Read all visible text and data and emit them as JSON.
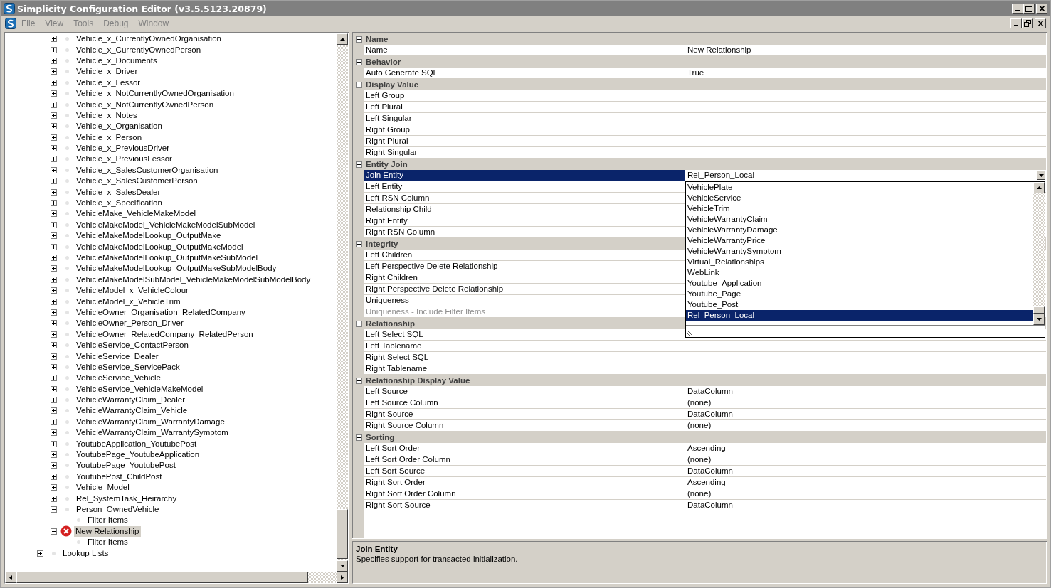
{
  "window": {
    "title": "Simplicity Configuration Editor (v3.5.5123.20879)",
    "active": false
  },
  "menu": [
    {
      "label": "File",
      "disabled": true
    },
    {
      "label": "View",
      "disabled": true
    },
    {
      "label": "Tools",
      "disabled": true
    },
    {
      "label": "Debug",
      "disabled": true
    },
    {
      "label": "Window",
      "disabled": true
    }
  ],
  "tree": {
    "items": [
      {
        "label": "Vehicle_x_CurrentlyOwnedOrganisation",
        "expanded": false,
        "selected": false,
        "error": false
      },
      {
        "label": "Vehicle_x_CurrentlyOwnedPerson",
        "expanded": false,
        "selected": false,
        "error": false
      },
      {
        "label": "Vehicle_x_Documents",
        "expanded": false,
        "selected": false,
        "error": false
      },
      {
        "label": "Vehicle_x_Driver",
        "expanded": false,
        "selected": false,
        "error": false
      },
      {
        "label": "Vehicle_x_Lessor",
        "expanded": false,
        "selected": false,
        "error": false
      },
      {
        "label": "Vehicle_x_NotCurrentlyOwnedOrganisation",
        "expanded": false,
        "selected": false,
        "error": false
      },
      {
        "label": "Vehicle_x_NotCurrentlyOwnedPerson",
        "expanded": false,
        "selected": false,
        "error": false
      },
      {
        "label": "Vehicle_x_Notes",
        "expanded": false,
        "selected": false,
        "error": false
      },
      {
        "label": "Vehicle_x_Organisation",
        "expanded": false,
        "selected": false,
        "error": false
      },
      {
        "label": "Vehicle_x_Person",
        "expanded": false,
        "selected": false,
        "error": false
      },
      {
        "label": "Vehicle_x_PreviousDriver",
        "expanded": false,
        "selected": false,
        "error": false
      },
      {
        "label": "Vehicle_x_PreviousLessor",
        "expanded": false,
        "selected": false,
        "error": false
      },
      {
        "label": "Vehicle_x_SalesCustomerOrganisation",
        "expanded": false,
        "selected": false,
        "error": false
      },
      {
        "label": "Vehicle_x_SalesCustomerPerson",
        "expanded": false,
        "selected": false,
        "error": false
      },
      {
        "label": "Vehicle_x_SalesDealer",
        "expanded": false,
        "selected": false,
        "error": false
      },
      {
        "label": "Vehicle_x_Specification",
        "expanded": false,
        "selected": false,
        "error": false
      },
      {
        "label": "VehicleMake_VehicleMakeModel",
        "expanded": false,
        "selected": false,
        "error": false
      },
      {
        "label": "VehicleMakeModel_VehicleMakeModelSubModel",
        "expanded": false,
        "selected": false,
        "error": false
      },
      {
        "label": "VehicleMakeModelLookup_OutputMake",
        "expanded": false,
        "selected": false,
        "error": false
      },
      {
        "label": "VehicleMakeModelLookup_OutputMakeModel",
        "expanded": false,
        "selected": false,
        "error": false
      },
      {
        "label": "VehicleMakeModelLookup_OutputMakeSubModel",
        "expanded": false,
        "selected": false,
        "error": false
      },
      {
        "label": "VehicleMakeModelLookup_OutputMakeSubModelBody",
        "expanded": false,
        "selected": false,
        "error": false
      },
      {
        "label": "VehicleMakeModelSubModel_VehicleMakeModelSubModelBody",
        "expanded": false,
        "selected": false,
        "error": false
      },
      {
        "label": "VehicleModel_x_VehicleColour",
        "expanded": false,
        "selected": false,
        "error": false
      },
      {
        "label": "VehicleModel_x_VehicleTrim",
        "expanded": false,
        "selected": false,
        "error": false
      },
      {
        "label": "VehicleOwner_Organisation_RelatedCompany",
        "expanded": false,
        "selected": false,
        "error": false
      },
      {
        "label": "VehicleOwner_Person_Driver",
        "expanded": false,
        "selected": false,
        "error": false
      },
      {
        "label": "VehicleOwner_RelatedCompany_RelatedPerson",
        "expanded": false,
        "selected": false,
        "error": false
      },
      {
        "label": "VehicleService_ContactPerson",
        "expanded": false,
        "selected": false,
        "error": false
      },
      {
        "label": "VehicleService_Dealer",
        "expanded": false,
        "selected": false,
        "error": false
      },
      {
        "label": "VehicleService_ServicePack",
        "expanded": false,
        "selected": false,
        "error": false
      },
      {
        "label": "VehicleService_Vehicle",
        "expanded": false,
        "selected": false,
        "error": false
      },
      {
        "label": "VehicleService_VehicleMakeModel",
        "expanded": false,
        "selected": false,
        "error": false
      },
      {
        "label": "VehicleWarrantyClaim_Dealer",
        "expanded": false,
        "selected": false,
        "error": false
      },
      {
        "label": "VehicleWarrantyClaim_Vehicle",
        "expanded": false,
        "selected": false,
        "error": false
      },
      {
        "label": "VehicleWarrantyClaim_WarrantyDamage",
        "expanded": false,
        "selected": false,
        "error": false
      },
      {
        "label": "VehicleWarrantyClaim_WarrantySymptom",
        "expanded": false,
        "selected": false,
        "error": false
      },
      {
        "label": "YoutubeApplication_YoutubePost",
        "expanded": false,
        "selected": false,
        "error": false
      },
      {
        "label": "YoutubePage_YoutubeApplication",
        "expanded": false,
        "selected": false,
        "error": false
      },
      {
        "label": "YoutubePage_YoutubePost",
        "expanded": false,
        "selected": false,
        "error": false
      },
      {
        "label": "YoutubePost_ChildPost",
        "expanded": false,
        "selected": false,
        "error": false
      },
      {
        "label": "Vehicle_Model",
        "expanded": false,
        "selected": false,
        "error": false
      },
      {
        "label": "Rel_SystemTask_Heirarchy",
        "expanded": false,
        "selected": false,
        "error": false
      },
      {
        "label": "Person_OwnedVehicle",
        "expanded": true,
        "selected": false,
        "error": false,
        "children": [
          {
            "label": "Filter Items",
            "selected": false,
            "error": false
          }
        ]
      },
      {
        "label": "New Relationship",
        "expanded": true,
        "selected": true,
        "error": true,
        "children": [
          {
            "label": "Filter Items",
            "selected": false,
            "error": false
          }
        ]
      }
    ],
    "trailing_items": [
      {
        "label": "Lookup Lists",
        "expanded": false,
        "selected": false,
        "error": false
      }
    ]
  },
  "properties": {
    "categories": [
      {
        "name": "Name",
        "expanded": true,
        "rows": [
          {
            "name": "Name",
            "value": "New Relationship",
            "selected": false,
            "disabled": false
          }
        ]
      },
      {
        "name": "Behavior",
        "expanded": true,
        "rows": [
          {
            "name": "Auto Generate SQL",
            "value": "True",
            "selected": false,
            "disabled": false
          }
        ]
      },
      {
        "name": "Display Value",
        "expanded": true,
        "rows": [
          {
            "name": "Left Group",
            "selected": false,
            "disabled": false
          },
          {
            "name": "Left Plural",
            "selected": false,
            "disabled": false
          },
          {
            "name": "Left Singular",
            "selected": false,
            "disabled": false
          },
          {
            "name": "Right Group",
            "selected": false,
            "disabled": false
          },
          {
            "name": "Right Plural",
            "selected": false,
            "disabled": false
          },
          {
            "name": "Right Singular",
            "selected": false,
            "disabled": false
          }
        ]
      },
      {
        "name": "Entity Join",
        "expanded": true,
        "rows": [
          {
            "name": "Join Entity",
            "value": "Rel_Person_Local",
            "selected": true,
            "disabled": false,
            "dropdown": {
              "options": [
                {
                  "label": "VehiclePlate",
                  "selected": false
                },
                {
                  "label": "VehicleService",
                  "selected": false
                },
                {
                  "label": "VehicleTrim",
                  "selected": false
                },
                {
                  "label": "VehicleWarrantyClaim",
                  "selected": false
                },
                {
                  "label": "VehicleWarrantyDamage",
                  "selected": false
                },
                {
                  "label": "VehicleWarrantyPrice",
                  "selected": false
                },
                {
                  "label": "VehicleWarrantySymptom",
                  "selected": false
                },
                {
                  "label": "Virtual_Relationships",
                  "selected": false
                },
                {
                  "label": "WebLink",
                  "selected": false
                },
                {
                  "label": "Youtube_Application",
                  "selected": false
                },
                {
                  "label": "Youtube_Page",
                  "selected": false
                },
                {
                  "label": "Youtube_Post",
                  "selected": false
                },
                {
                  "label": "Rel_Person_Local",
                  "selected": true
                }
              ]
            }
          },
          {
            "name": "Left Entity",
            "selected": false,
            "disabled": false
          },
          {
            "name": "Left RSN Column",
            "selected": false,
            "disabled": false
          },
          {
            "name": "Relationship Child",
            "selected": false,
            "disabled": false
          },
          {
            "name": "Right Entity",
            "selected": false,
            "disabled": false
          },
          {
            "name": "Right RSN Column",
            "selected": false,
            "disabled": false
          }
        ]
      },
      {
        "name": "Integrity",
        "expanded": true,
        "rows": [
          {
            "name": "Left Children",
            "selected": false,
            "disabled": false
          },
          {
            "name": "Left Perspective Delete Relationship",
            "selected": false,
            "disabled": false
          },
          {
            "name": "Right Children",
            "selected": false,
            "disabled": false
          },
          {
            "name": "Right Perspective Delete Relationship",
            "selected": false,
            "disabled": false
          },
          {
            "name": "Uniqueness",
            "selected": false,
            "disabled": false
          },
          {
            "name": "Uniqueness - Include Filter Items",
            "selected": false,
            "disabled": true
          }
        ]
      },
      {
        "name": "Relationship",
        "expanded": true,
        "rows": [
          {
            "name": "Left Select SQL",
            "selected": false,
            "disabled": false
          },
          {
            "name": "Left Tablename",
            "selected": false,
            "disabled": false
          },
          {
            "name": "Right Select SQL",
            "selected": false,
            "disabled": false
          },
          {
            "name": "Right Tablename",
            "selected": false,
            "disabled": false
          }
        ]
      },
      {
        "name": "Relationship Display Value",
        "expanded": true,
        "rows": [
          {
            "name": "Left Source",
            "value": "DataColumn",
            "selected": false,
            "disabled": false
          },
          {
            "name": "Left Source Column",
            "value": "(none)",
            "selected": false,
            "disabled": false
          },
          {
            "name": "Right Source",
            "value": "DataColumn",
            "selected": false,
            "disabled": false
          },
          {
            "name": "Right Source Column",
            "value": "(none)",
            "selected": false,
            "disabled": false
          }
        ]
      },
      {
        "name": "Sorting",
        "expanded": true,
        "rows": [
          {
            "name": "Left Sort Order",
            "value": "Ascending",
            "selected": false,
            "disabled": false
          },
          {
            "name": "Left Sort Order Column",
            "value": "(none)",
            "selected": false,
            "disabled": false
          },
          {
            "name": "Left Sort Source",
            "value": "DataColumn",
            "selected": false,
            "disabled": false
          },
          {
            "name": "Right Sort Order",
            "value": "Ascending",
            "selected": false,
            "disabled": false
          },
          {
            "name": "Right Sort Order Column",
            "value": "(none)",
            "selected": false,
            "disabled": false
          },
          {
            "name": "Right Sort Source",
            "value": "DataColumn",
            "selected": false,
            "disabled": false
          }
        ]
      }
    ]
  },
  "description": {
    "title": "Join Entity",
    "text": "Specifies support for transacted initialization."
  }
}
